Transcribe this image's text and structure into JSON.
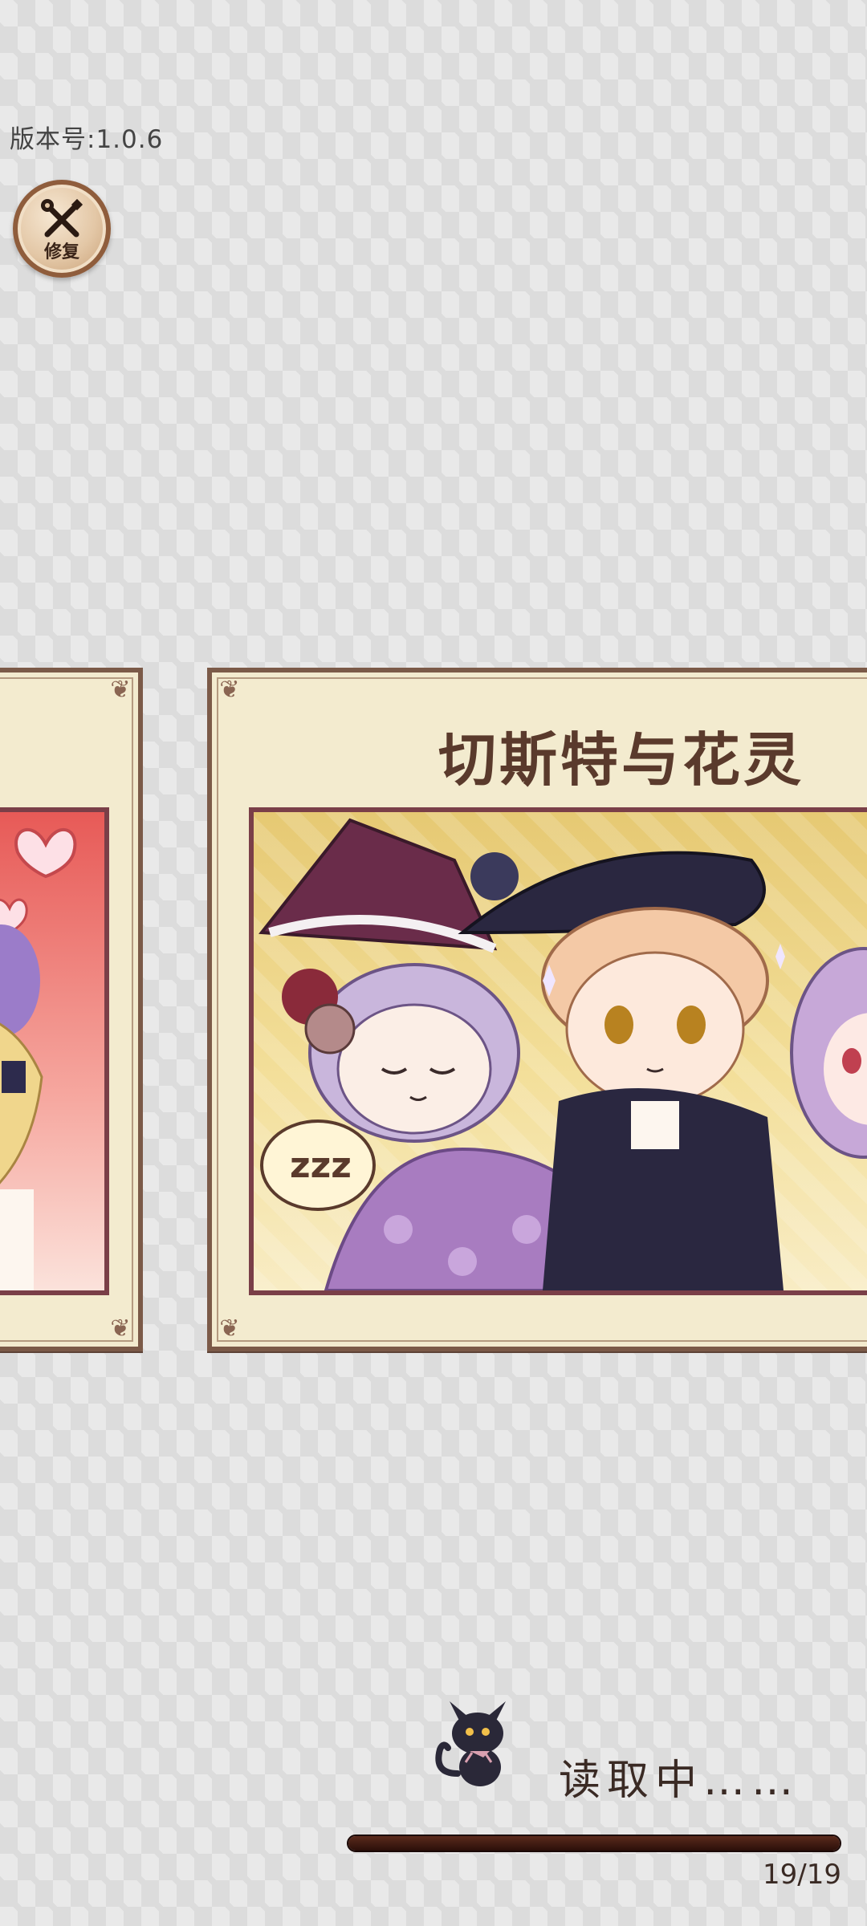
{
  "version_label": "版本号:1.0.6",
  "repair_button": {
    "label": "修复",
    "icon": "wrench-screwdriver-icon"
  },
  "cards": {
    "left": {
      "title": ""
    },
    "main": {
      "title": "切斯特与花灵"
    }
  },
  "loading": {
    "text": "读取中……",
    "progress_text": "19/19",
    "progress": 1.0,
    "mascot_icon": "black-cat-icon"
  }
}
